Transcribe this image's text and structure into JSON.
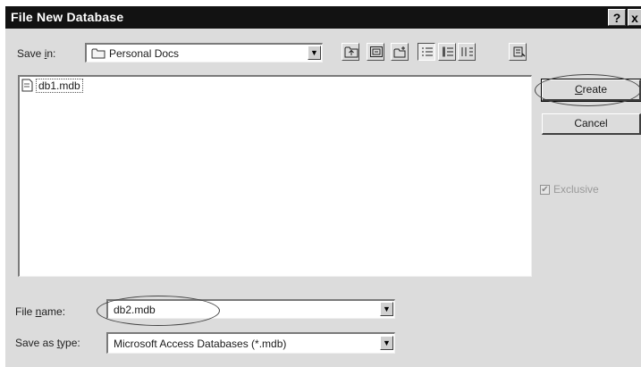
{
  "window": {
    "title": "File New Database",
    "help_label": "?",
    "close_label": "x"
  },
  "save_in": {
    "label_pre": "Save ",
    "label_key": "i",
    "label_post": "n:",
    "value": "Personal Docs"
  },
  "toolbar": {
    "icons": [
      "up-one-level-icon",
      "search-web-icon",
      "create-new-folder-icon",
      "list-view-icon",
      "details-view-icon",
      "properties-view-icon",
      "commands-settings-icon"
    ]
  },
  "files": [
    {
      "name": "db1.mdb"
    }
  ],
  "buttons": {
    "create_key": "C",
    "create_rest": "reate",
    "cancel": "Cancel"
  },
  "exclusive": {
    "label": "Exclusive",
    "checked": true
  },
  "file_name": {
    "label_pre": "File ",
    "label_key": "n",
    "label_post": "ame:",
    "value": "db2.mdb"
  },
  "save_as_type": {
    "label_pre": "Save as ",
    "label_key": "t",
    "label_post": "ype:",
    "value": "Microsoft Access Databases (*.mdb)"
  }
}
